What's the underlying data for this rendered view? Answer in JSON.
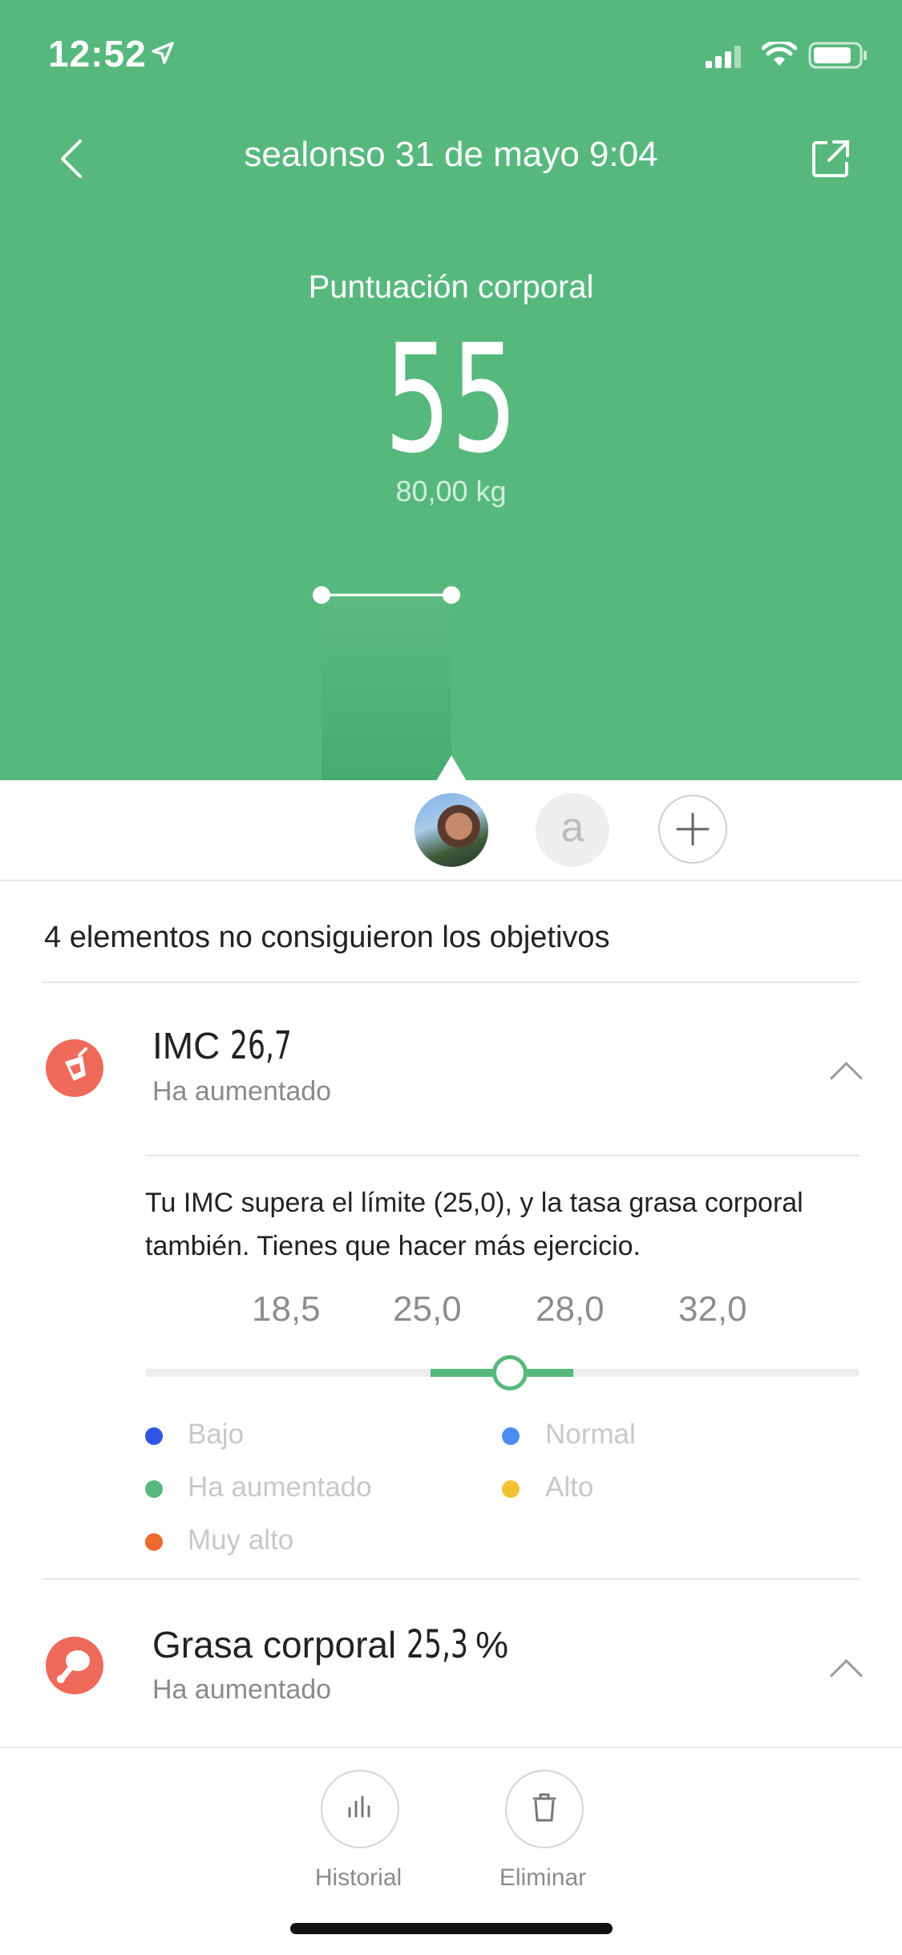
{
  "status_bar": {
    "time": "12:52"
  },
  "header": {
    "title": "sealonso 31 de mayo 9:04",
    "score_label": "Puntuación corporal",
    "score": "55",
    "weight": "80,00 kg"
  },
  "avatars": {
    "second_initial": "a"
  },
  "summary": "4 elementos no consiguieron los objetivos",
  "imc": {
    "label": "IMC",
    "value": "26,7",
    "status": "Ha aumentado",
    "description": "Tu IMC supera el límite (25,0), y la tasa grasa corporal también. Tienes que hacer más ejercicio.",
    "ticks": [
      "18,5",
      "25,0",
      "28,0",
      "32,0"
    ],
    "marker_value": 26.7,
    "legend": [
      {
        "label": "Bajo",
        "color": "#2f55e4"
      },
      {
        "label": "Normal",
        "color": "#4a8cf0"
      },
      {
        "label": "Ha aumentado",
        "color": "#57b87d"
      },
      {
        "label": "Alto",
        "color": "#f2c232"
      },
      {
        "label": "Muy alto",
        "color": "#ee6a2e"
      }
    ]
  },
  "body_fat": {
    "label": "Grasa corporal",
    "value": "25,3",
    "unit": "%",
    "status": "Ha aumentado"
  },
  "bottom_bar": {
    "history_label": "Historial",
    "delete_label": "Eliminar"
  },
  "colors": {
    "brand_green": "#57b87d",
    "warning_red": "#ef6a5a"
  }
}
